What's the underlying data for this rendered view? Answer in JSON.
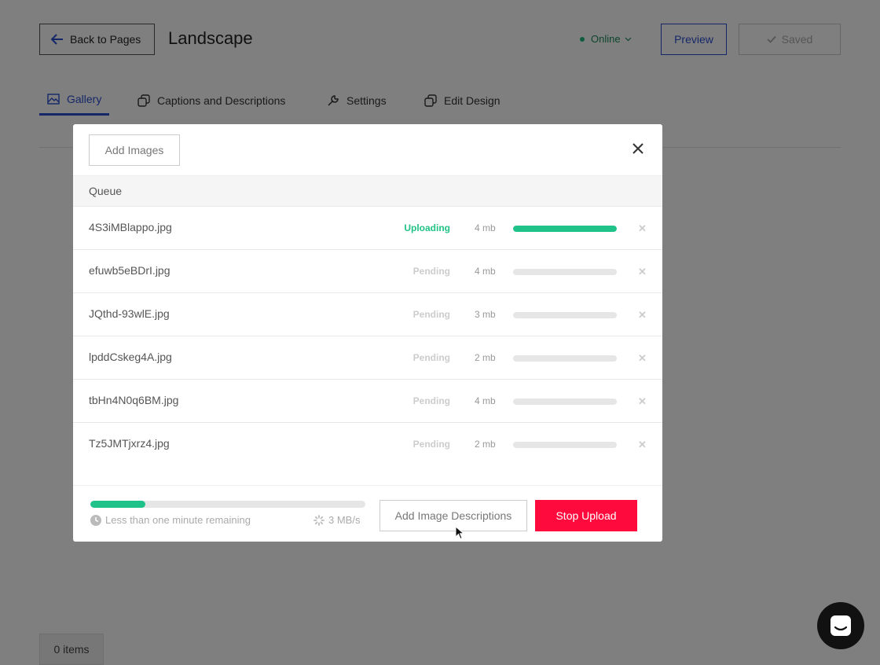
{
  "header": {
    "back_label": "Back to Pages",
    "title": "Landscape",
    "status": "Online",
    "preview_label": "Preview",
    "saved_label": "Saved"
  },
  "tabs": [
    {
      "label": "Gallery",
      "icon": "image-icon",
      "active": true
    },
    {
      "label": "Captions and Descriptions",
      "icon": "copy-icon",
      "active": false
    },
    {
      "label": "Settings",
      "icon": "wrench-icon",
      "active": false
    },
    {
      "label": "Edit Design",
      "icon": "copy-icon",
      "active": false
    }
  ],
  "items_count": "0 items",
  "modal": {
    "add_images_label": "Add Images",
    "queue_label": "Queue",
    "files": [
      {
        "name": "4S3iMBlappo.jpg",
        "status": "Uploading",
        "size": "4 mb",
        "progress": 1.0
      },
      {
        "name": "efuwb5eBDrI.jpg",
        "status": "Pending",
        "size": "4 mb",
        "progress": 0
      },
      {
        "name": "JQthd-93wlE.jpg",
        "status": "Pending",
        "size": "3 mb",
        "progress": 0
      },
      {
        "name": "lpddCskeg4A.jpg",
        "status": "Pending",
        "size": "2 mb",
        "progress": 0
      },
      {
        "name": "tbHn4N0q6BM.jpg",
        "status": "Pending",
        "size": "4 mb",
        "progress": 0
      },
      {
        "name": "Tz5JMTjxrz4.jpg",
        "status": "Pending",
        "size": "2 mb",
        "progress": 0
      }
    ],
    "total_progress": 0.2,
    "remaining": "Less than one minute remaining",
    "speed": "3 MB/s",
    "add_descriptions_label": "Add Image Descriptions",
    "stop_label": "Stop Upload"
  },
  "colors": {
    "accent": "#2a4ed0",
    "success": "#1fc38a",
    "danger": "#ff0a3c"
  }
}
